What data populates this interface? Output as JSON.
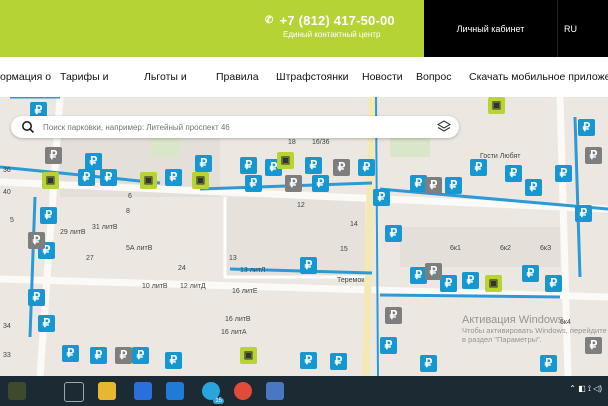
{
  "header": {
    "phone": "+7 (812) 417-50-00",
    "phone_subtitle": "Единый контактный центр",
    "cabinet": "Личный кабинет",
    "lang": "RU",
    "accent": "#b5d334"
  },
  "nav": {
    "items": [
      {
        "label": "ормация о"
      },
      {
        "label": "Тарифы и"
      },
      {
        "label": "Льготы и"
      },
      {
        "label": "Правила"
      },
      {
        "label": "Штрафстоянки"
      },
      {
        "label": "Новости"
      },
      {
        "label": "Вопрос"
      },
      {
        "label": "Скачать мобильное приложе"
      }
    ]
  },
  "search": {
    "placeholder": "Поиск парковки, например: Литейный проспект 46"
  },
  "map": {
    "parking_symbol": "₽",
    "labels": [
      "16/36",
      "18",
      "20",
      "22",
      "Гости Любят",
      "40",
      "36",
      "6",
      "8",
      "12",
      "14",
      "5",
      "29 литВ",
      "31 литВ",
      "27",
      "5А литВ",
      "24",
      "13",
      "13 литЛ",
      "15",
      "10 литВ",
      "12 литД",
      "16 литЕ",
      "16 литВ",
      "16 литА",
      "6к1",
      "6к2",
      "6кЗ",
      "6к4",
      "34",
      "33",
      "Теремок"
    ],
    "watermark_line1": "Активация Windows",
    "watermark_line2": "Чтобы активировать Windows, перейдите в раздел \"Параметры\"."
  },
  "taskbar": {
    "badge": "15"
  }
}
